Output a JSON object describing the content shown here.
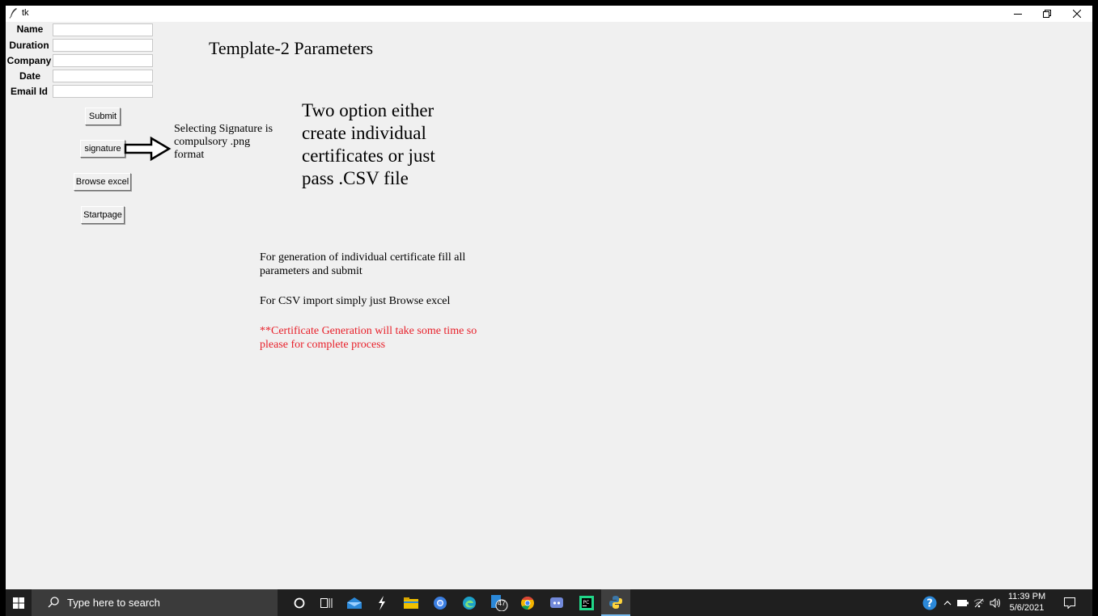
{
  "window": {
    "title": "tk"
  },
  "form": {
    "name_label": "Name",
    "duration_label": "Duration",
    "company_label": "Company",
    "date_label": "Date",
    "email_label": "Email Id",
    "name_value": "",
    "duration_value": "",
    "company_value": "",
    "date_value": "",
    "email_value": ""
  },
  "buttons": {
    "submit": "Submit",
    "signature": "signature",
    "browse_excel": "Browse excel",
    "startpage": "Startpage"
  },
  "heading": "Template-2 Parameters",
  "signature_note": [
    "Selecting Signature is",
    "compulsory .png",
    "format"
  ],
  "options_note": [
    "Two option either",
    "create individual",
    "certificates or just",
    "pass .CSV file"
  ],
  "instructions": {
    "individual": [
      "For generation of individual certificate fill all",
      "parameters and submit"
    ],
    "csv": "For CSV import simply just Browse excel",
    "warning": [
      "**Certificate Generation will take some time so",
      "please for complete process"
    ],
    "warning_color": "#e8202a"
  },
  "taskbar": {
    "search_placeholder": "Type here to search",
    "badge_count": "47",
    "time": "11:39 PM",
    "date": "5/6/2021",
    "icons": [
      "windows-start-icon",
      "search-icon",
      "cortana-icon",
      "task-view-icon",
      "mail-icon",
      "app-icon",
      "file-explorer-icon",
      "chrome-canary-icon",
      "edge-icon",
      "taskbar-app-badge-icon",
      "chrome-icon",
      "discord-icon",
      "pycharm-icon",
      "python-icon",
      "help-icon",
      "tray-chevron-icon",
      "battery-icon",
      "wifi-icon",
      "volume-icon",
      "notifications-icon"
    ]
  }
}
